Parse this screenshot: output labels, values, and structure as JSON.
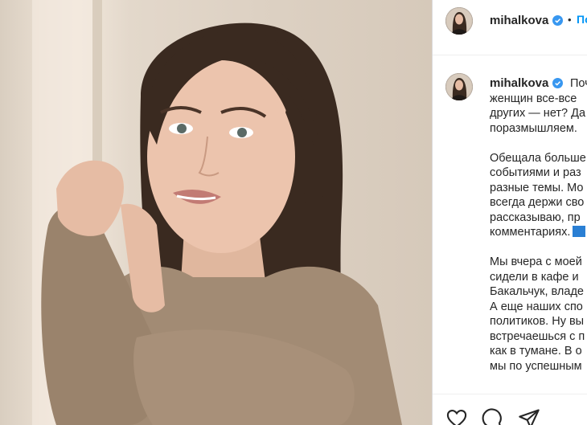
{
  "post": {
    "username": "mihalkova",
    "follow_label": "Подписаться",
    "separator": "•",
    "caption_lines": [
      "Почему",
      "женщин все-все",
      "других — нет? Да",
      "поразмышляем.",
      "",
      "Обещала больше",
      "событиями и раз",
      "разные темы. Мо",
      "всегда держи сво",
      "рассказываю, пр",
      "комментариях.",
      "",
      "Мы вчера с моей",
      "сидели в кафе и",
      "Бакальчук, владе",
      "А еще наших спо",
      "политиков. Ну вы",
      "встречаешься с п",
      "как в тумане. В о",
      "мы по успешным"
    ]
  },
  "icons": {
    "verified": "verified-badge-icon",
    "like": "heart-icon",
    "comment": "comment-icon",
    "share": "paper-plane-icon"
  },
  "colors": {
    "link_blue": "#0095f6",
    "verified_blue": "#3897f0",
    "text": "#262626",
    "sweater": "#a28b74"
  }
}
